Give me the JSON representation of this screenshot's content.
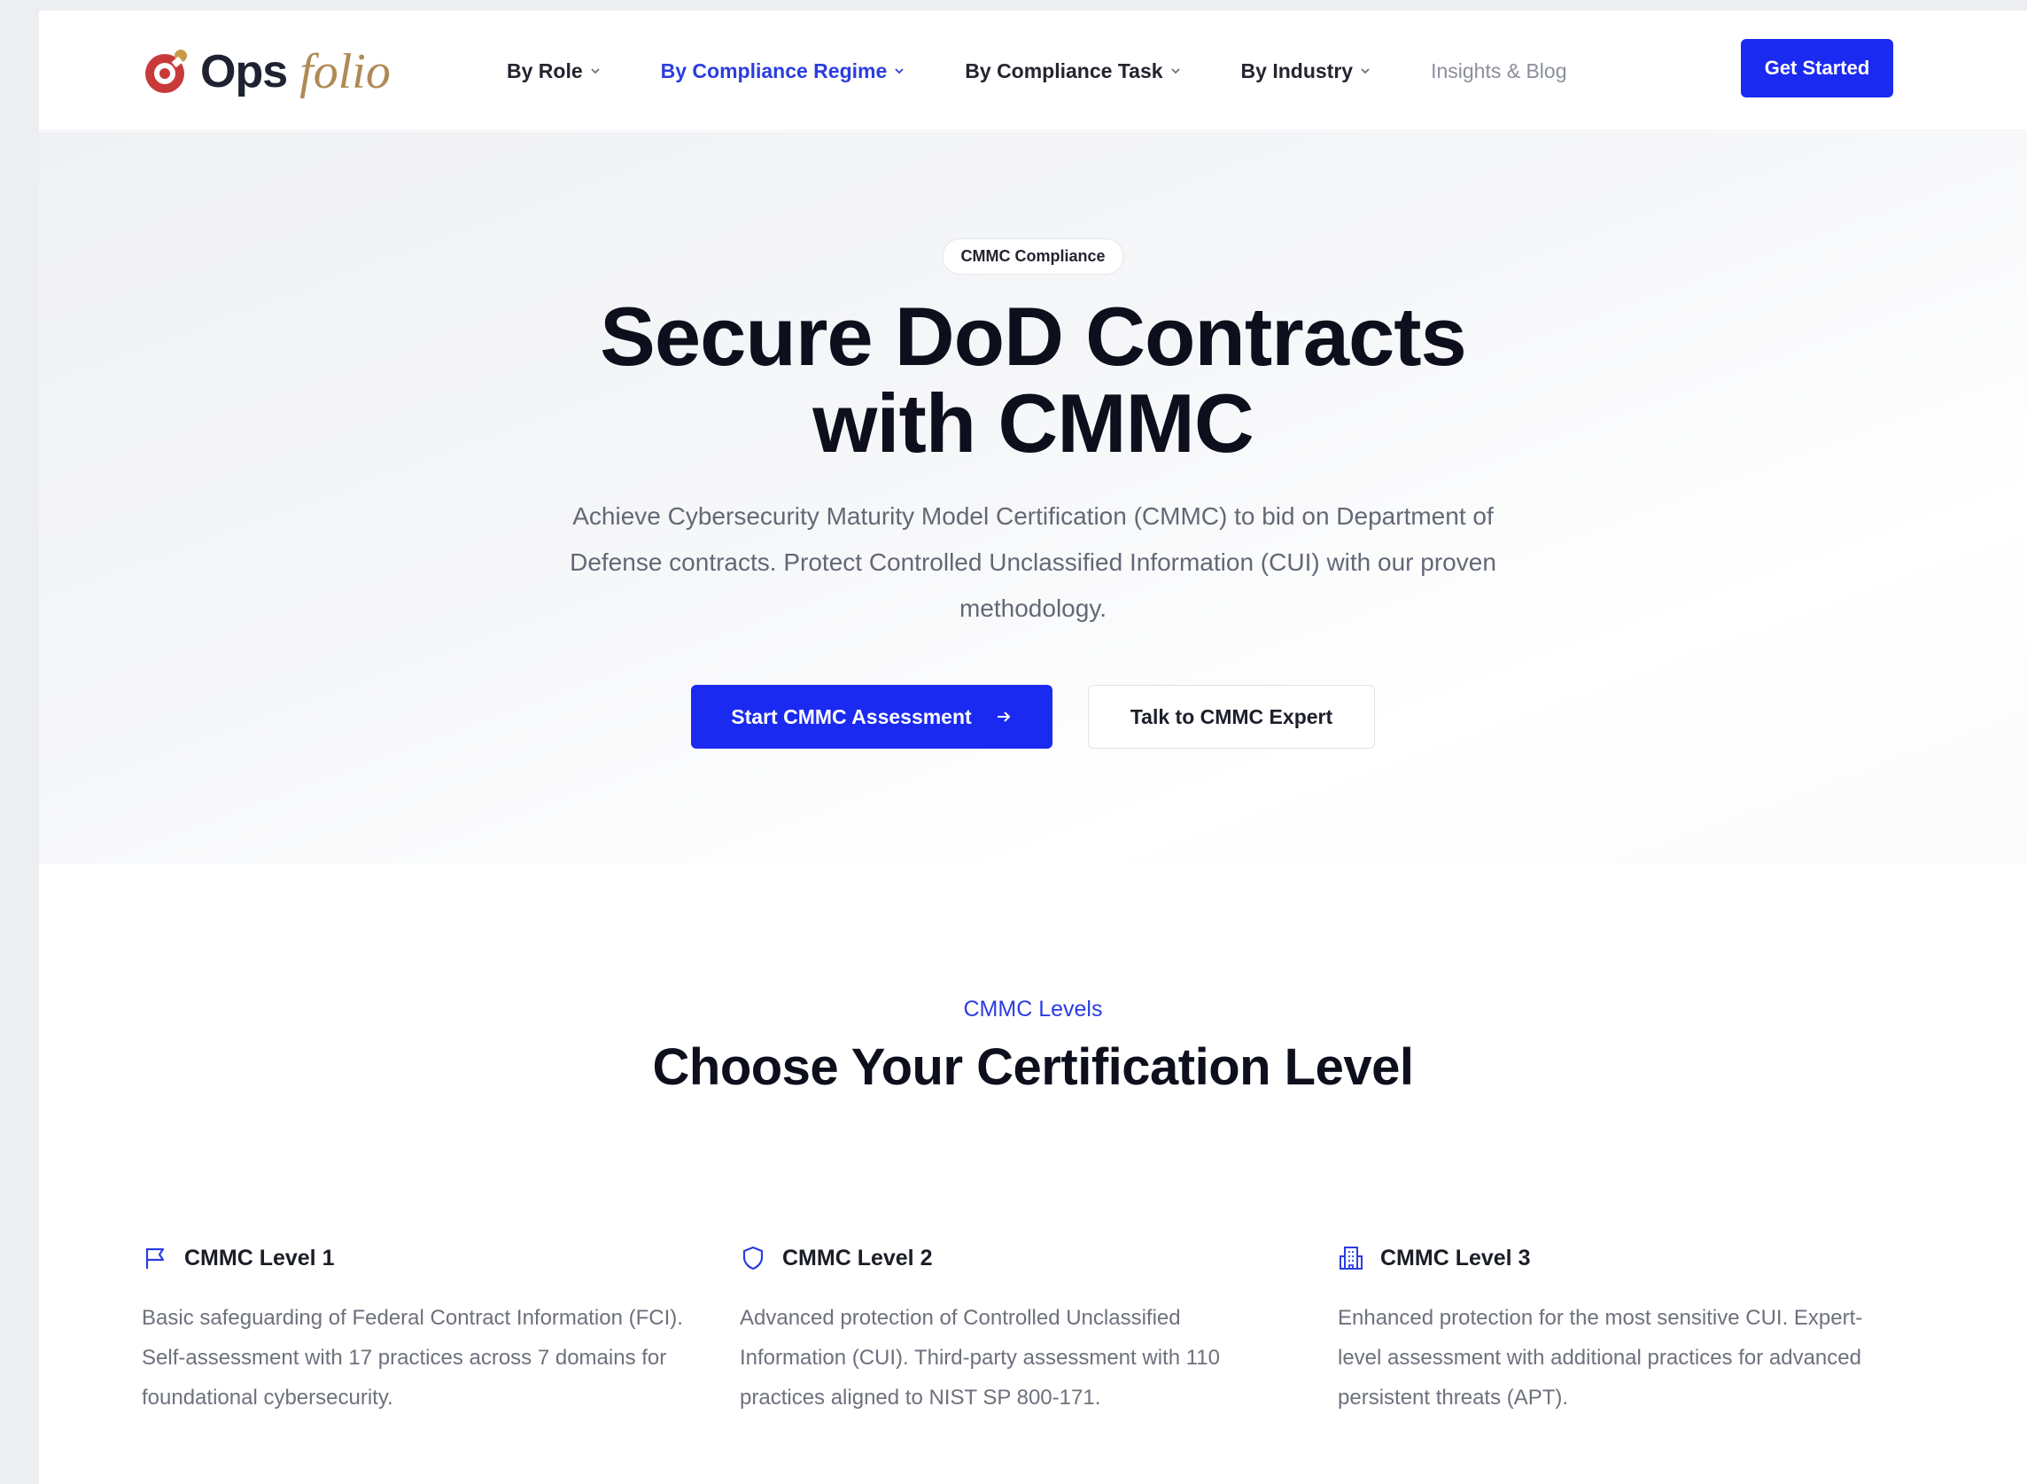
{
  "brand": {
    "name_part1": "Ops",
    "name_part2": "folio"
  },
  "nav": {
    "items": [
      {
        "label": "By Role",
        "dropdown": true,
        "state": "default"
      },
      {
        "label": "By Compliance Regime",
        "dropdown": true,
        "state": "active"
      },
      {
        "label": "By Compliance Task",
        "dropdown": true,
        "state": "default"
      },
      {
        "label": "By Industry",
        "dropdown": true,
        "state": "default"
      },
      {
        "label": "Insights & Blog",
        "dropdown": false,
        "state": "muted"
      }
    ],
    "cta_label": "Get Started"
  },
  "hero": {
    "badge": "CMMC Compliance",
    "title_line1": "Secure DoD Contracts",
    "title_line2": "with CMMC",
    "subtitle": "Achieve Cybersecurity Maturity Model Certification (CMMC) to bid on Department of Defense contracts. Protect Controlled Unclassified Information (CUI) with our proven methodology.",
    "primary_cta": "Start CMMC Assessment",
    "secondary_cta": "Talk to CMMC Expert"
  },
  "levels": {
    "eyebrow": "CMMC Levels",
    "title": "Choose Your Certification Level",
    "cards": [
      {
        "icon": "flag-icon",
        "title": "CMMC Level 1",
        "description": "Basic safeguarding of Federal Contract Information (FCI). Self-assessment with 17 practices across 7 domains for foundational cybersecurity."
      },
      {
        "icon": "shield-icon",
        "title": "CMMC Level 2",
        "description": "Advanced protection of Controlled Unclassified Information (CUI). Third-party assessment with 110 practices aligned to NIST SP 800-171."
      },
      {
        "icon": "building-icon",
        "title": "CMMC Level 3",
        "description": "Enhanced protection for the most sensitive CUI. Expert-level assessment with additional practices for advanced persistent threats (APT)."
      }
    ]
  },
  "colors": {
    "accent": "#1b2af0",
    "accent_text": "#2a3de0",
    "brand_red": "#c83a3a",
    "brand_gold": "#b08a55",
    "heading": "#0d0f1c",
    "body_text": "#636875"
  }
}
